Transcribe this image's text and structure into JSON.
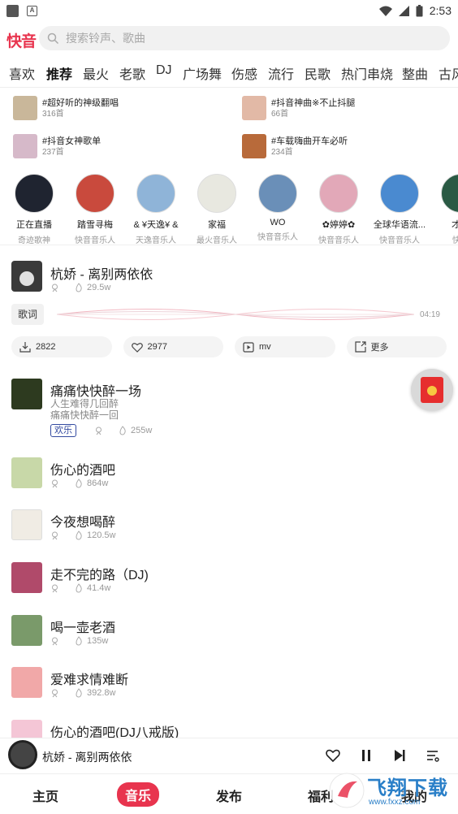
{
  "status_bar": {
    "time": "2:53"
  },
  "header": {
    "logo_text": "快音",
    "search_placeholder": "搜索铃声、歌曲"
  },
  "tabs": [
    "喜欢",
    "推荐",
    "最火",
    "老歌",
    "DJ",
    "广场舞",
    "伤感",
    "流行",
    "民歌",
    "热门串烧",
    "整曲",
    "古风"
  ],
  "active_tab": "推荐",
  "playlists": [
    {
      "title": "#超好听的神级翻唱",
      "count": "316首",
      "color": "#c9b79a"
    },
    {
      "title": "#抖音神曲※不止抖腿",
      "count": "66首",
      "color": "#e2b9a6"
    },
    {
      "title": "#抖音女神歌单",
      "count": "237首",
      "color": "#d6b9c9"
    },
    {
      "title": "#车载嗨曲开车必听",
      "count": "234首",
      "color": "#b86a3a"
    }
  ],
  "artists": [
    {
      "name": "正在直播",
      "sub": "奇迹歌神",
      "color": "#1f2430"
    },
    {
      "name": "踏雪寻梅",
      "sub": "快音音乐人",
      "color": "#c94a3d"
    },
    {
      "name": "& ¥天逸¥ &",
      "sub": "天逸音乐人",
      "color": "#8fb4d8"
    },
    {
      "name": "家福",
      "sub": "最火音乐人",
      "color": "#e8e8e0"
    },
    {
      "name": "WO",
      "sub": "快音音乐人",
      "color": "#6a8fb8"
    },
    {
      "name": "✿婷婷✿",
      "sub": "快音音乐人",
      "color": "#e2a8b8"
    },
    {
      "name": "全球华语流...",
      "sub": "快音音乐人",
      "color": "#4a8ad0"
    },
    {
      "name": "才仁",
      "sub": "快音",
      "color": "#2a5a44"
    }
  ],
  "now_playing": {
    "title": "杭娇 - 离别两依依",
    "plays": "29.5w",
    "lyrics_label": "歌词",
    "duration": "04:19",
    "actions": [
      {
        "icon": "download-icon",
        "label": "2822"
      },
      {
        "icon": "heart-icon",
        "label": "2977"
      },
      {
        "icon": "video-icon",
        "label": "mv"
      },
      {
        "icon": "share-icon",
        "label": "更多"
      }
    ]
  },
  "songs": [
    {
      "title": "痛痛快快醉一场",
      "desc": [
        "人生难得几回醉",
        "痛痛快快醉一回"
      ],
      "tag": "欢乐",
      "plays": "255w",
      "color": "#2d3a1f"
    },
    {
      "title": "伤心的酒吧",
      "plays": "864w",
      "color": "#c8d8a8"
    },
    {
      "title": "今夜想喝醉",
      "plays": "120.5w",
      "color": "#f0ece4"
    },
    {
      "title": "走不完的路（DJ)",
      "plays": "41.4w",
      "color": "#b04a6a"
    },
    {
      "title": "喝一壶老酒",
      "plays": "135w",
      "color": "#7a9a6a"
    },
    {
      "title": "爱难求情难断",
      "plays": "392.8w",
      "color": "#f1a8a8"
    },
    {
      "title": "伤心的酒吧(DJ八戒版)",
      "plays": "",
      "color": "#f4c6d6"
    }
  ],
  "mini_player": {
    "title": "杭娇 - 离别两依依"
  },
  "bottom_nav": [
    "主页",
    "音乐",
    "发布",
    "福利",
    "我的"
  ],
  "active_nav": "音乐",
  "watermark": {
    "text": "飞翔下载",
    "sub": "www.fxxz.com"
  },
  "colors": {
    "accent": "#e8344e",
    "tag": "#334aa0"
  }
}
